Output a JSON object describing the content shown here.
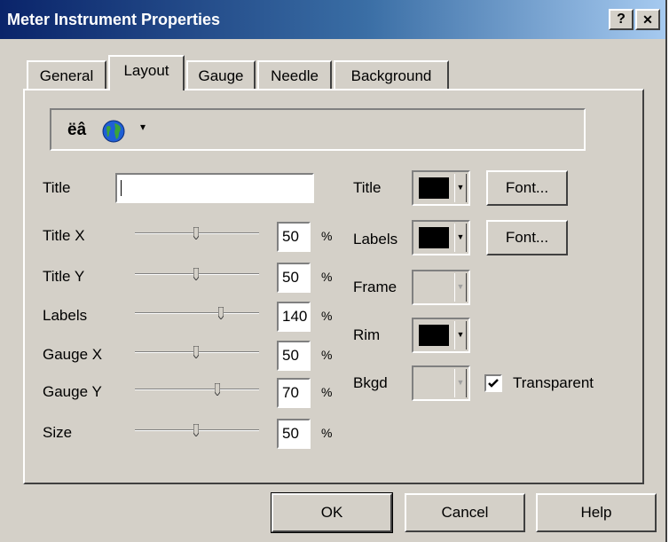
{
  "window": {
    "title": "Meter Instrument Properties",
    "help_glyph": "?",
    "close_glyph": "✕"
  },
  "tabs": [
    "General",
    "Layout",
    "Gauge",
    "Needle",
    "Background"
  ],
  "active_tab": "Layout",
  "toolbar": {
    "chars": "ëâ",
    "globe_icon": "globe-icon",
    "dropdown_glyph": "▾"
  },
  "fields": {
    "title_label": "Title",
    "title_value": "",
    "sliders": [
      {
        "label": "Title X",
        "value": "50",
        "unit": "%"
      },
      {
        "label": "Title Y",
        "value": "50",
        "unit": "%"
      },
      {
        "label": "Labels",
        "value": "140",
        "unit": "%"
      },
      {
        "label": "Gauge X",
        "value": "50",
        "unit": "%"
      },
      {
        "label": "Gauge Y",
        "value": "70",
        "unit": "%"
      },
      {
        "label": "Size",
        "value": "50",
        "unit": "%"
      }
    ]
  },
  "colors": {
    "title_label": "Title",
    "title_color": "#000000",
    "labels_label": "Labels",
    "labels_color": "#000000",
    "frame_label": "Frame",
    "rim_label": "Rim",
    "rim_color": "#000000",
    "bkgd_label": "Bkgd",
    "font_button": "Font...",
    "transparent_label": "Transparent",
    "transparent_checked": true
  },
  "buttons": {
    "ok": "OK",
    "cancel": "Cancel",
    "help": "Help"
  }
}
